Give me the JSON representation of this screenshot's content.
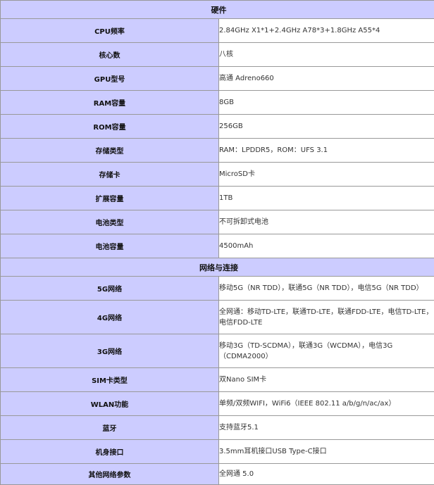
{
  "sections": [
    {
      "title": "硬件",
      "rows": [
        {
          "label": "CPU频率",
          "value": "2.84GHz X1*1+2.4GHz A78*3+1.8GHz A55*4"
        },
        {
          "label": "核心数",
          "value": "八核"
        },
        {
          "label": "GPU型号",
          "value": "高通 Adreno660"
        },
        {
          "label": "RAM容量",
          "value": "8GB"
        },
        {
          "label": "ROM容量",
          "value": "256GB"
        },
        {
          "label": "存储类型",
          "value": "RAM：LPDDR5，ROM：UFS 3.1"
        },
        {
          "label": "存储卡",
          "value": "MicroSD卡"
        },
        {
          "label": "扩展容量",
          "value": "1TB"
        },
        {
          "label": "电池类型",
          "value": "不可拆卸式电池"
        },
        {
          "label": "电池容量",
          "value": "4500mAh"
        }
      ]
    },
    {
      "title": "网络与连接",
      "rows": [
        {
          "label": "5G网络",
          "value": "移动5G（NR TDD），联通5G（NR TDD），电信5G（NR TDD）"
        },
        {
          "label": "4G网络",
          "value": "全网通：移动TD-LTE，联通TD-LTE，联通FDD-LTE，电信TD-LTE，电信FDD-LTE"
        },
        {
          "label": "3G网络",
          "value": "移动3G（TD-SCDMA），联通3G（WCDMA），电信3G（CDMA2000）"
        },
        {
          "label": "SIM卡类型",
          "value": "双Nano SIM卡"
        },
        {
          "label": "WLAN功能",
          "value": "单频/双频WIFI，WiFi6（IEEE 802.11 a/b/g/n/ac/ax）"
        },
        {
          "label": "蓝牙",
          "value": "支持蓝牙5.1"
        },
        {
          "label": "机身接口",
          "value": "3.5mm耳机接口USB Type-C接口"
        },
        {
          "label": "其他网络参数",
          "value": "全网通 5.0"
        }
      ]
    }
  ]
}
